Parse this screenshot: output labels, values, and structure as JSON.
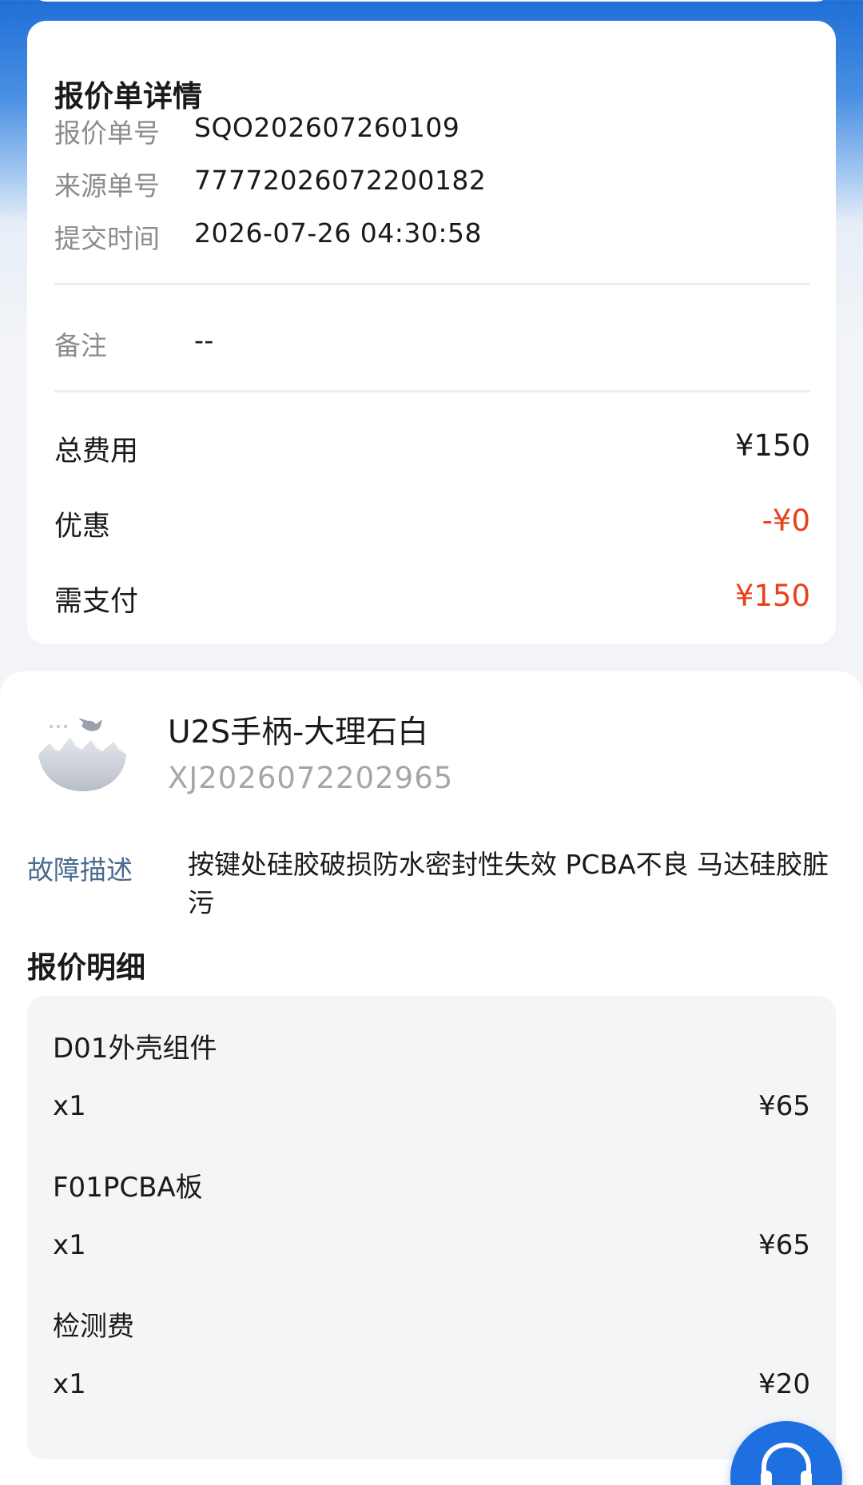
{
  "quote": {
    "title": "报价单详情",
    "rows": [
      {
        "label": "报价单号",
        "value": "SQO202607260109"
      },
      {
        "label": "来源单号",
        "value": "77772026072200182"
      },
      {
        "label": "提交时间",
        "value": "2026-07-26 04:30:58"
      }
    ],
    "remark": {
      "label": "备注",
      "value": "--"
    },
    "fees": {
      "total": {
        "label": "总费用",
        "value": "¥150"
      },
      "discount": {
        "label": "优惠",
        "value": "-¥0"
      },
      "payable": {
        "label": "需支付",
        "value": "¥150"
      }
    }
  },
  "product": {
    "name": "U2S手柄-大理石白",
    "code": "XJ2026072202965",
    "image_icon": "placeholder-mountain-bird-icon",
    "fault_label": "故障描述",
    "fault_text": "按键处硅胶破损防水密封性失效 PCBA不良 马达硅胶脏污"
  },
  "details": {
    "title": "报价明细",
    "items": [
      {
        "name": "D01外壳组件",
        "qty": "x1",
        "price": "¥65"
      },
      {
        "name": "F01PCBA板",
        "qty": "x1",
        "price": "¥65"
      },
      {
        "name": "检测费",
        "qty": "x1",
        "price": "¥20"
      }
    ]
  },
  "support": {
    "icon": "headset-icon"
  },
  "colors": {
    "accent": "#1e6fe0",
    "price_red": "#e8401c",
    "label_gray": "#8c8c8c"
  }
}
